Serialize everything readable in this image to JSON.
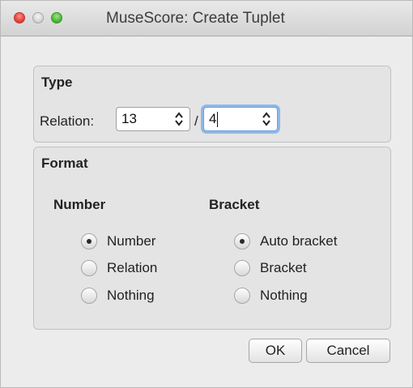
{
  "window": {
    "title": "MuseScore: Create Tuplet"
  },
  "type_group": {
    "title": "Type",
    "relation_label": "Relation:",
    "relation_numerator": "13",
    "separator": "/",
    "relation_denominator": "4"
  },
  "format_group": {
    "title": "Format",
    "number": {
      "heading": "Number",
      "options": [
        "Number",
        "Relation",
        "Nothing"
      ],
      "selected": "Number"
    },
    "bracket": {
      "heading": "Bracket",
      "options": [
        "Auto bracket",
        "Bracket",
        "Nothing"
      ],
      "selected": "Auto bracket"
    }
  },
  "buttons": {
    "ok": "OK",
    "cancel": "Cancel"
  }
}
